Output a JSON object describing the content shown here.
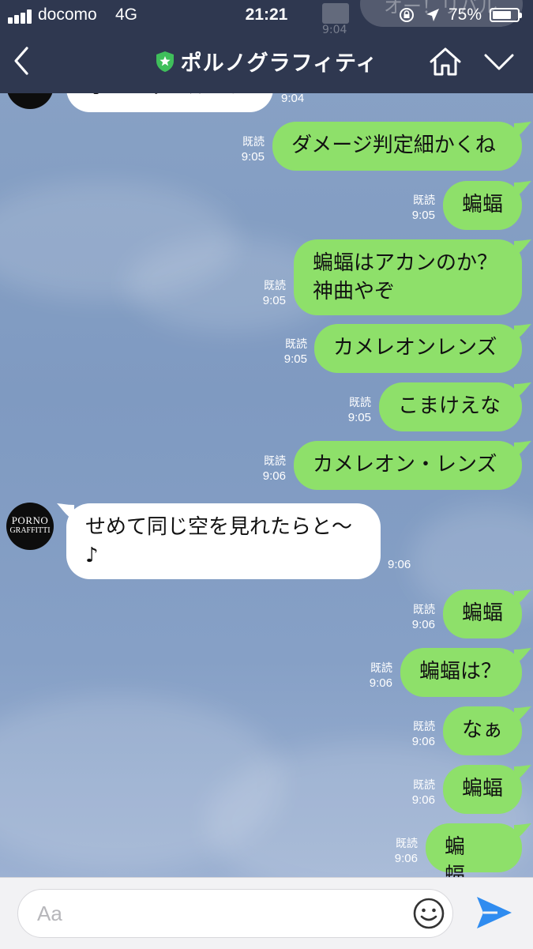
{
  "status_bar": {
    "carrier": "docomo",
    "network": "4G",
    "time": "21:21",
    "battery": "75%",
    "battery_level": 0.75
  },
  "header": {
    "title": "ポルノグラフィティ",
    "icons": [
      "back-chevron-icon",
      "shield-star-icon",
      "home-icon",
      "chevron-down-icon"
    ]
  },
  "peek": {
    "text": "オー！リバル",
    "time": "9:04"
  },
  "avatar": {
    "line1": "PORNO",
    "line2": "GRAFFITTI"
  },
  "messages": [
    {
      "dir": "in",
      "text": "オー！リバル〜♪",
      "time": "9:04"
    },
    {
      "dir": "out",
      "text": "ダメージ判定細かくね",
      "read": "既読",
      "time": "9:05"
    },
    {
      "dir": "out",
      "text": "蝙蝠",
      "read": "既読",
      "time": "9:05"
    },
    {
      "dir": "out",
      "text": "蝙蝠はアカンのか？\n神曲やぞ",
      "read": "既読",
      "time": "9:05"
    },
    {
      "dir": "out",
      "text": "カメレオンレンズ",
      "read": "既読",
      "time": "9:05"
    },
    {
      "dir": "out",
      "text": "こまけえな",
      "read": "既読",
      "time": "9:05"
    },
    {
      "dir": "out",
      "text": "カメレオン・レンズ",
      "read": "既読",
      "time": "9:06"
    },
    {
      "dir": "in",
      "text": "せめて同じ空を見れたらと〜\n♪",
      "time": "9:06"
    },
    {
      "dir": "out",
      "text": "蝙蝠",
      "read": "既読",
      "time": "9:06"
    },
    {
      "dir": "out",
      "text": "蝙蝠は？",
      "read": "既読",
      "time": "9:06"
    },
    {
      "dir": "out",
      "text": "なぁ",
      "read": "既読",
      "time": "9:06"
    },
    {
      "dir": "out",
      "text": "蝙蝠",
      "read": "既読",
      "time": "9:06"
    },
    {
      "dir": "out",
      "text": "蝙蝠…",
      "read": "既読",
      "time": "9:06"
    }
  ],
  "input_bar": {
    "placeholder": "Aa",
    "icons": [
      "emoji-icon",
      "send-icon"
    ]
  },
  "colors": {
    "header": "#2f3850",
    "outgoing": "#8ee06a",
    "incoming": "#ffffff",
    "send": "#2f8cf0"
  }
}
